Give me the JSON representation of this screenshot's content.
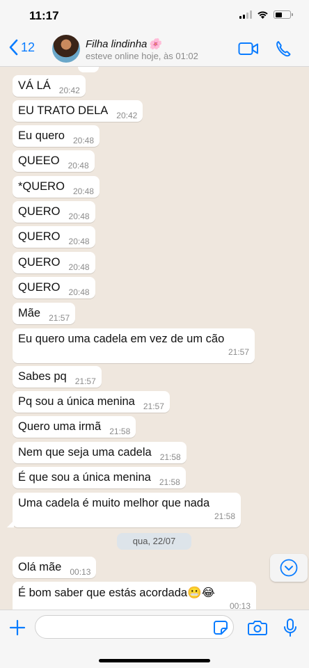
{
  "status_bar": {
    "time": "11:17"
  },
  "header": {
    "back_count": "12",
    "contact_name": "Filha lindinha",
    "contact_emoji": "🌸",
    "contact_status": "esteve online hoje, às 01:02"
  },
  "messages": [
    {
      "text": "VÁ LÁ",
      "time": "20:42"
    },
    {
      "text": "EU TRATO DELA",
      "time": "20:42"
    },
    {
      "text": "Eu quero",
      "time": "20:48"
    },
    {
      "text": "QUEEO",
      "time": "20:48"
    },
    {
      "text": "*QUERO",
      "time": "20:48"
    },
    {
      "text": "QUERO",
      "time": "20:48"
    },
    {
      "text": "QUERO",
      "time": "20:48"
    },
    {
      "text": "QUERO",
      "time": "20:48"
    },
    {
      "text": "QUERO",
      "time": "20:48"
    },
    {
      "text": "Mãe",
      "time": "21:57"
    },
    {
      "text": "Eu quero uma cadela em vez de um cão",
      "time": "21:57"
    },
    {
      "text": "Sabes pq",
      "time": "21:57"
    },
    {
      "text": "Pq sou a única menina",
      "time": "21:57"
    },
    {
      "text": "Quero uma irmã",
      "time": "21:58"
    },
    {
      "text": "Nem que seja uma cadela",
      "time": "21:58"
    },
    {
      "text": "É que sou a única menina",
      "time": "21:58"
    },
    {
      "text": "Uma cadela é muito melhor que nada",
      "time": "21:58"
    },
    {
      "text": "Olá mãe",
      "time": "00:13"
    },
    {
      "text": "É bom saber que estás acordada😬😂",
      "time": "00:13"
    }
  ],
  "date_divider": "qua, 22/07",
  "input": {
    "value": ""
  },
  "icons": {
    "back": "chevron-left-icon",
    "video": "video-call-icon",
    "phone": "phone-icon",
    "scroll": "chevron-down-icon",
    "plus": "plus-icon",
    "sticker": "sticker-icon",
    "camera": "camera-icon",
    "mic": "microphone-icon"
  },
  "colors": {
    "accent": "#0a7cff",
    "chat_bg": "#efe7de",
    "bubble": "#ffffff",
    "date_chip": "#dde4ea"
  }
}
